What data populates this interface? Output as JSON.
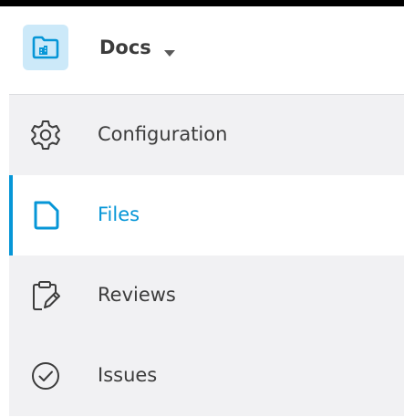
{
  "app": {
    "title": "Docs",
    "icon": "folder-building-icon",
    "accent_color": "#0696d7",
    "icon_bg_color": "#cce9f9"
  },
  "nav": {
    "items": [
      {
        "label": "Configuration",
        "icon": "gear-icon",
        "active": false
      },
      {
        "label": "Files",
        "icon": "file-icon",
        "active": true
      },
      {
        "label": "Reviews",
        "icon": "clipboard-pencil-icon",
        "active": false
      },
      {
        "label": "Issues",
        "icon": "check-circle-icon",
        "active": false
      }
    ]
  }
}
